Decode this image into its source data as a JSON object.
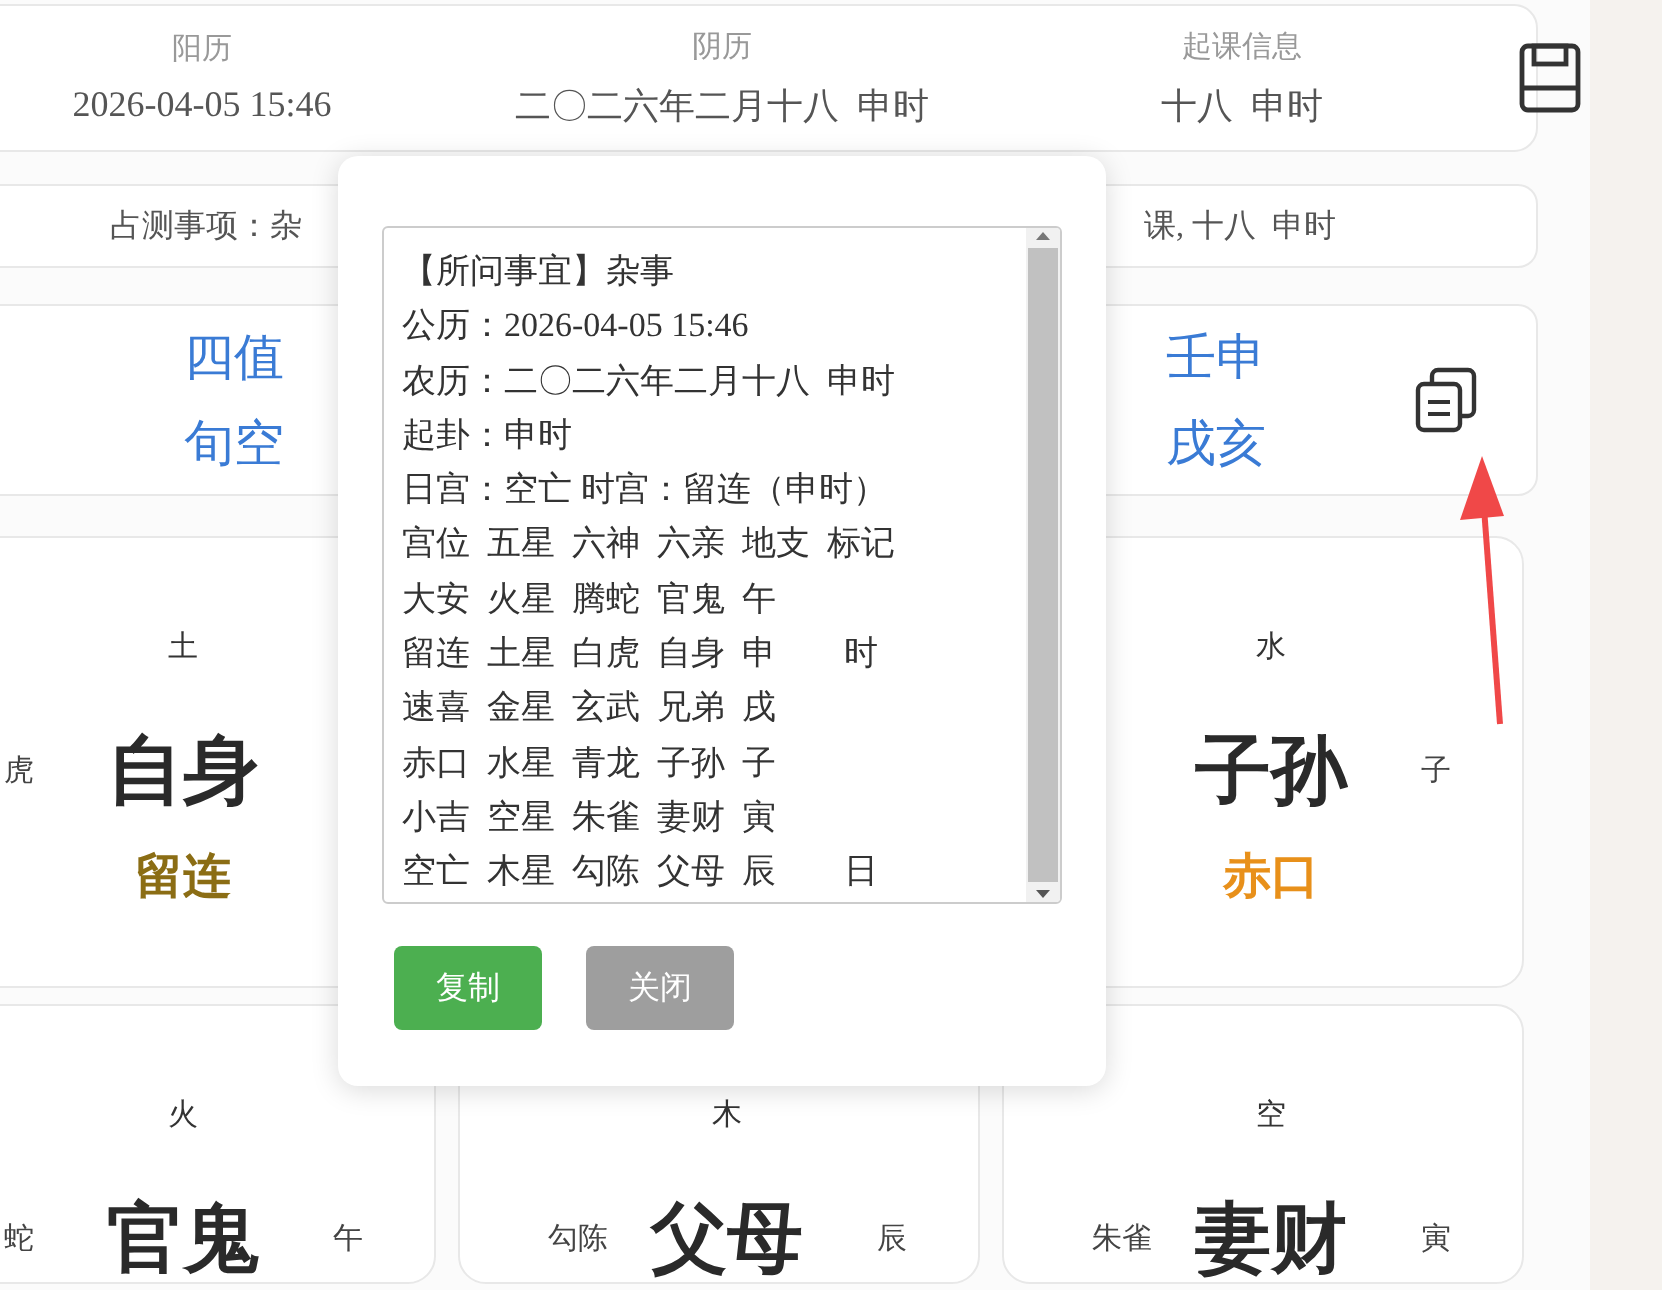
{
  "date_header": {
    "columns": [
      {
        "label": "阳历",
        "value": "2026-04-05 15:46"
      },
      {
        "label": "阴历",
        "value": "二〇二六年二月十八  申时"
      },
      {
        "label": "起课信息",
        "value": "十八  申时"
      }
    ]
  },
  "summary": {
    "left": "占测事项：杂",
    "right": "课, 十八  申时"
  },
  "info_card": {
    "left": [
      "四值",
      "旬空"
    ],
    "right": [
      "壬申",
      "戌亥"
    ]
  },
  "palace_rows": [
    [
      {
        "element": "土",
        "god": "虎",
        "relative": "自身",
        "name": "留连",
        "color": "#8b6d14"
      },
      null,
      {
        "element": "水",
        "relative": "子孙",
        "branch": "子",
        "name": "赤口",
        "color": "#e8901a"
      }
    ],
    [
      {
        "element": "火",
        "god": "蛇",
        "relative": "官鬼",
        "branch": "午"
      },
      {
        "element": "木",
        "god": "勾陈",
        "relative": "父母",
        "branch": "辰"
      },
      {
        "element": "空",
        "god": "朱雀",
        "relative": "妻财",
        "branch": "寅"
      }
    ]
  ],
  "dialog": {
    "lines": [
      "【所问事宜】杂事",
      "公历：2026-04-05 15:46",
      "农历：二〇二六年二月十八  申时",
      "起卦：申时",
      "日宫：空亡 时宫：留连（申时）",
      "宫位  五星  六神  六亲  地支  标记",
      "大安  火星  腾蛇  官鬼  午",
      "留连  土星  白虎  自身  申        时",
      "速喜  金星  玄武  兄弟  戌",
      "赤口  水星  青龙  子孙  子",
      "小吉  空星  朱雀  妻财  寅",
      "空亡  木星  勾陈  父母  辰        日"
    ],
    "buttons": [
      {
        "label": "复制",
        "kind": "primary"
      },
      {
        "label": "关闭",
        "kind": "secondary"
      }
    ]
  }
}
